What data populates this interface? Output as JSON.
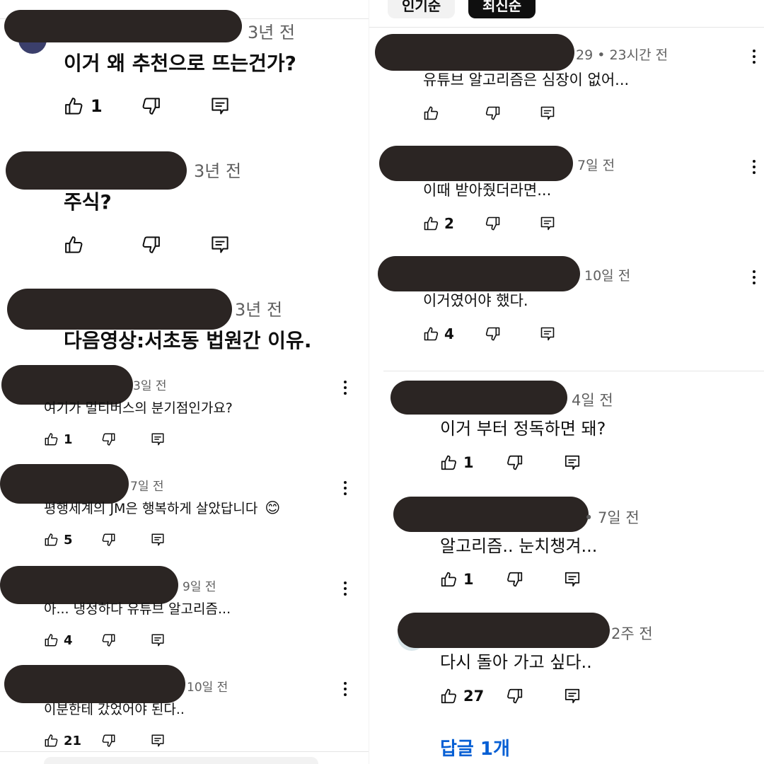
{
  "left": {
    "comments": [
      {
        "time": "3년 전",
        "text": "이거 왜 추천으로 뜨는건가?",
        "likes": "1"
      },
      {
        "time": "3년 전",
        "text": "주식?",
        "likes": ""
      },
      {
        "time": "3년 전",
        "text": "다음영상:서초동 법원간 이유.",
        "likes": ""
      },
      {
        "time": "3일 전",
        "text": "여기가 멀티버스의 분기점인가요?",
        "likes": "1"
      },
      {
        "time": "7일 전",
        "text": "평행세계의 JM은 행복하게 살았답니다",
        "emoji": "😊",
        "likes": "5"
      },
      {
        "time": "9일 전",
        "text": "아... 냉정하다 유튜브 알고리즘...",
        "likes": "4"
      },
      {
        "time": "10일 전",
        "text": "이분한테 갔었어야 된다..",
        "likes": "21"
      }
    ]
  },
  "right": {
    "chips": [
      "인기순",
      "최신순"
    ],
    "comments": [
      {
        "time": "29 • 23시간 전",
        "text": "유튜브 알고리즘은 심장이 없어...",
        "likes": ""
      },
      {
        "time": "7일 전",
        "text": "이때 받아줬더라면...",
        "likes": "2"
      },
      {
        "time": "10일 전",
        "text": "이거였어야 했다.",
        "likes": "4"
      },
      {
        "time": "4일 전",
        "text": "이거 부터 정독하면 돼?",
        "likes": "1"
      },
      {
        "time": "• 7일 전",
        "text": "알고리즘.. 눈치챙겨...",
        "likes": "1"
      },
      {
        "time": "2주 전",
        "text": "다시 돌아 가고 싶다..",
        "likes": "27"
      }
    ],
    "replies_label": "답글 1개"
  },
  "icons": {
    "like": "thumbs-up-icon",
    "dislike": "thumbs-down-icon",
    "reply": "reply-icon",
    "more": "more-vert-icon"
  },
  "colors": {
    "meta": "#606060",
    "link": "#065fd4",
    "redaction": "#2b2523"
  }
}
